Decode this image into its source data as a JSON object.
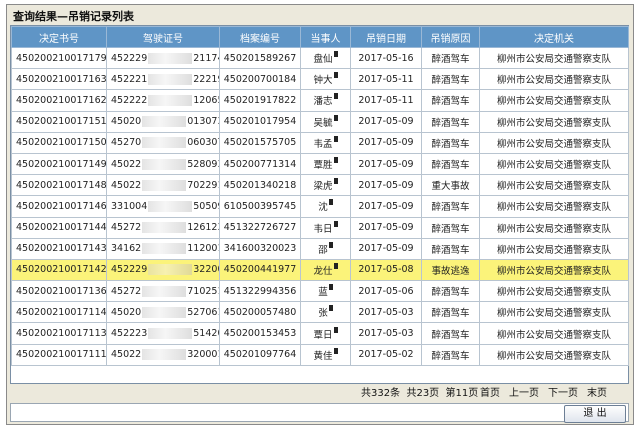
{
  "window": {
    "title": "查询结果—吊销记录列表"
  },
  "table": {
    "headers": [
      "决定书号",
      "驾驶证号",
      "档案编号",
      "当事人",
      "吊销日期",
      "吊销原因",
      "决定机关"
    ],
    "rows": [
      {
        "decision_no": "450200210017179",
        "license_prefix": "452229",
        "license_suffix": "2117422",
        "file_no": "450201589267",
        "party": "盘仙",
        "date": "2017-05-16",
        "reason": "醉酒驾车",
        "authority": "柳州市公安局交通警察支队"
      },
      {
        "decision_no": "450200210017163",
        "license_prefix": "452221",
        "license_suffix": "2221918",
        "file_no": "450200700184",
        "party": "钟大",
        "date": "2017-05-11",
        "reason": "醉酒驾车",
        "authority": "柳州市公安局交通警察支队"
      },
      {
        "decision_no": "450200210017162",
        "license_prefix": "452222",
        "license_suffix": "12065817",
        "file_no": "450201917822",
        "party": "潘志",
        "date": "2017-05-11",
        "reason": "醉酒驾车",
        "authority": "柳州市公安局交通警察支队"
      },
      {
        "decision_no": "450200210017151",
        "license_prefix": "45020",
        "license_suffix": "0130733",
        "file_no": "450201017954",
        "party": "吴毓",
        "date": "2017-05-09",
        "reason": "醉酒驾车",
        "authority": "柳州市公安局交通警察支队"
      },
      {
        "decision_no": "450200210017150",
        "license_prefix": "45270",
        "license_suffix": "06030775",
        "file_no": "450201575705",
        "party": "韦孟",
        "date": "2017-05-09",
        "reason": "醉酒驾车",
        "authority": "柳州市公安局交通警察支队"
      },
      {
        "decision_no": "450200210017149",
        "license_prefix": "45022",
        "license_suffix": "5280930",
        "file_no": "450200771314",
        "party": "覃胜",
        "date": "2017-05-09",
        "reason": "醉酒驾车",
        "authority": "柳州市公安局交通警察支队"
      },
      {
        "decision_no": "450200210017148",
        "license_prefix": "45022",
        "license_suffix": "7022918",
        "file_no": "450201340218",
        "party": "梁虎",
        "date": "2017-05-09",
        "reason": "重大事故",
        "authority": "柳州市公安局交通警察支队"
      },
      {
        "decision_no": "450200210017146",
        "license_prefix": "331004",
        "license_suffix": "5050936",
        "file_no": "610500395745",
        "party": "沈",
        "date": "2017-05-09",
        "reason": "醉酒驾车",
        "authority": "柳州市公安局交通警察支队"
      },
      {
        "decision_no": "450200210017144",
        "license_prefix": "45272",
        "license_suffix": "1261230",
        "file_no": "451322726727",
        "party": "韦日",
        "date": "2017-05-09",
        "reason": "醉酒驾车",
        "authority": "柳州市公安局交通警察支队"
      },
      {
        "decision_no": "450200210017143",
        "license_prefix": "34162",
        "license_suffix": "1120013",
        "file_no": "341600320023",
        "party": "邵",
        "date": "2017-05-09",
        "reason": "醉酒驾车",
        "authority": "柳州市公安局交通警察支队"
      },
      {
        "decision_no": "450200210017142",
        "license_prefix": "452229",
        "license_suffix": "322001X",
        "file_no": "450200441977",
        "party": "龙仕",
        "date": "2017-05-08",
        "reason": "事故逃逸",
        "authority": "柳州市公安局交通警察支队",
        "selected": true
      },
      {
        "decision_no": "450200210017136",
        "license_prefix": "45272",
        "license_suffix": "7102516",
        "file_no": "451322994356",
        "party": "蓝",
        "date": "2017-05-06",
        "reason": "醉酒驾车",
        "authority": "柳州市公安局交通警察支队"
      },
      {
        "decision_no": "450200210017114",
        "license_prefix": "45020",
        "license_suffix": "5270619",
        "file_no": "450200057480",
        "party": "张",
        "date": "2017-05-03",
        "reason": "醉酒驾车",
        "authority": "柳州市公安局交通警察支队"
      },
      {
        "decision_no": "450200210017113",
        "license_prefix": "452223",
        "license_suffix": "5142030",
        "file_no": "450200153453",
        "party": "覃日",
        "date": "2017-05-03",
        "reason": "醉酒驾车",
        "authority": "柳州市公安局交通警察支队"
      },
      {
        "decision_no": "450200210017111",
        "license_prefix": "45022",
        "license_suffix": "3200019",
        "file_no": "450201097764",
        "party": "黄佳",
        "date": "2017-05-02",
        "reason": "醉酒驾车",
        "authority": "柳州市公安局交通警察支队"
      }
    ]
  },
  "pagination": {
    "total_records": "共332条",
    "total_pages": "共23页",
    "current_page": "第11页",
    "first": "首页",
    "prev": "上一页",
    "next": "下一页",
    "last": "末页"
  },
  "buttons": {
    "exit": "退 出"
  },
  "colors": {
    "header_bg": "#5f95c6",
    "selected_row": "#fbf37a",
    "window_bg": "#ece9dc"
  }
}
